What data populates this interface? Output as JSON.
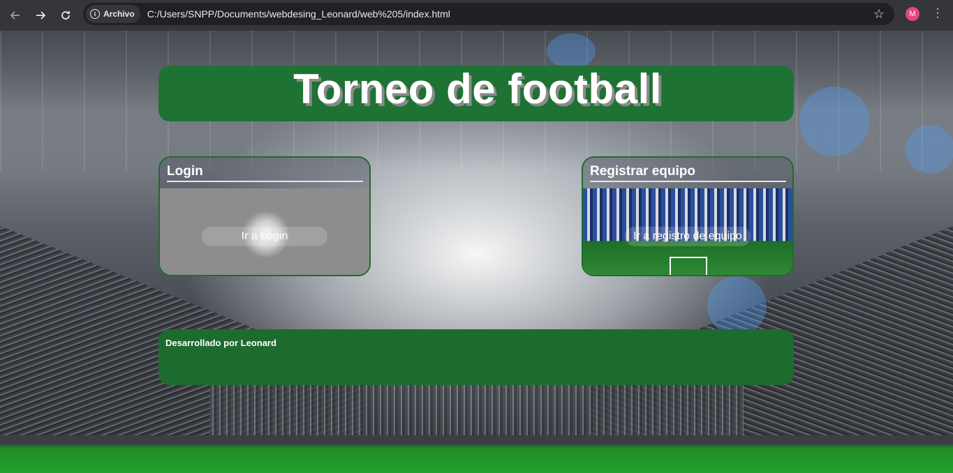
{
  "browser": {
    "chip_label": "Archivo",
    "url": "C:/Users/SNPP/Documents/webdesing_Leonard/web%205/index.html",
    "avatar_letter": "M"
  },
  "page": {
    "title": "Torneo de football",
    "cards": [
      {
        "title": "Login",
        "button": "Ir a Login"
      },
      {
        "title": "Registrar equipo",
        "button": "Ir a registro de equipo"
      }
    ],
    "footer": "Desarrollado por Leonard"
  },
  "colors": {
    "header_bg": "#1e7233",
    "footer_bg": "#1e6b30",
    "card_border": "#1e6b30"
  }
}
